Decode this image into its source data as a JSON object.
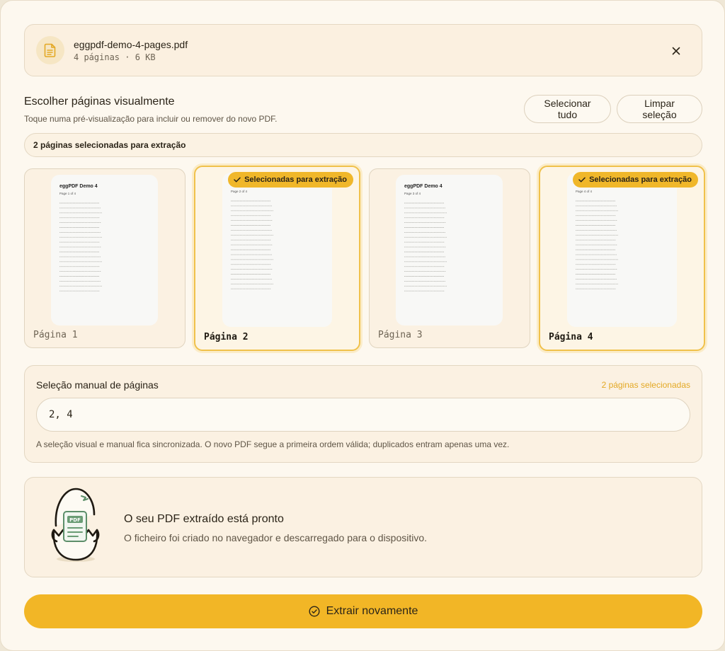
{
  "file": {
    "name": "eggpdf-demo-4-pages.pdf",
    "meta": "4 páginas · 6 KB",
    "icon": "document-icon"
  },
  "visual": {
    "title": "Escolher páginas visualmente",
    "subtitle": "Toque numa pré-visualização para incluir ou remover do novo PDF.",
    "select_all_label": "Selecionar tudo",
    "clear_label": "Limpar seleção",
    "banner": "2 páginas selecionadas para extração"
  },
  "pages": [
    {
      "label": "Página 1",
      "selected": false,
      "thumb_title": "eggPDF Demo 4",
      "thumb_sub": "Page 1 of 4"
    },
    {
      "label": "Página 2",
      "selected": true,
      "badge": "Selecionadas para extração",
      "thumb_title": "eggPDF Demo 4",
      "thumb_sub": "Page 2 of 4"
    },
    {
      "label": "Página 3",
      "selected": false,
      "thumb_title": "eggPDF Demo 4",
      "thumb_sub": "Page 3 of 4"
    },
    {
      "label": "Página 4",
      "selected": true,
      "badge": "Selecionadas para extração",
      "thumb_title": "eggPDF Demo 4",
      "thumb_sub": "Page 4 of 4"
    }
  ],
  "manual": {
    "title": "Seleção manual de páginas",
    "count": "2 páginas selecionadas",
    "value": "2, 4",
    "note": "A seleção visual e manual fica sincronizada. O novo PDF segue a primeira ordem válida; duplicados entram apenas uma vez."
  },
  "success": {
    "title": "O seu PDF extraído está pronto",
    "description": "O ficheiro foi criado no navegador e descarregado para o dispositivo.",
    "egg_badge": "PDF"
  },
  "cta": {
    "label": "Extrair novamente",
    "icon": "check-circle-icon"
  },
  "colors": {
    "accent": "#f2b626",
    "background": "#fdf8ef",
    "card": "#fbf1e2"
  }
}
